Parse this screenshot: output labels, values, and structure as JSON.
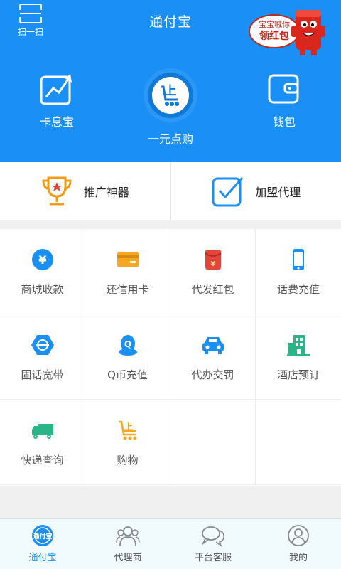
{
  "header": {
    "scan_label": "扫一扫",
    "title": "通付宝",
    "redpack_line1": "宝宝喊你",
    "redpack_line2": "领红包"
  },
  "features": [
    {
      "label": "卡息宝",
      "icon": "chart-card-icon"
    },
    {
      "label": "一元点购",
      "icon": "shopping-cart-icon"
    },
    {
      "label": "钱包",
      "icon": "wallet-icon"
    }
  ],
  "promo": [
    {
      "label": "推广神器",
      "icon": "trophy-icon"
    },
    {
      "label": "加盟代理",
      "icon": "checkbox-icon"
    }
  ],
  "services": [
    {
      "label": "商城收款",
      "icon": "yuan-icon"
    },
    {
      "label": "还信用卡",
      "icon": "credit-card-icon"
    },
    {
      "label": "代发红包",
      "icon": "red-envelope-icon"
    },
    {
      "label": "话费充值",
      "icon": "phone-icon"
    },
    {
      "label": "固话宽带",
      "icon": "broadband-icon"
    },
    {
      "label": "Q币充值",
      "icon": "qq-icon"
    },
    {
      "label": "代办交罚",
      "icon": "car-icon"
    },
    {
      "label": "酒店预订",
      "icon": "hotel-icon"
    },
    {
      "label": "快递查询",
      "icon": "truck-icon"
    },
    {
      "label": "购物",
      "icon": "cart-icon"
    }
  ],
  "tabs": [
    {
      "label": "通付宝",
      "icon": "home-logo-icon",
      "active": true
    },
    {
      "label": "代理商",
      "icon": "agents-icon",
      "active": false
    },
    {
      "label": "平台客服",
      "icon": "chat-icon",
      "active": false
    },
    {
      "label": "我的",
      "icon": "user-icon",
      "active": false
    }
  ],
  "colors": {
    "primary": "#1a8ff5",
    "orange": "#f5a623",
    "red": "#e2463b",
    "green": "#2bb586"
  }
}
